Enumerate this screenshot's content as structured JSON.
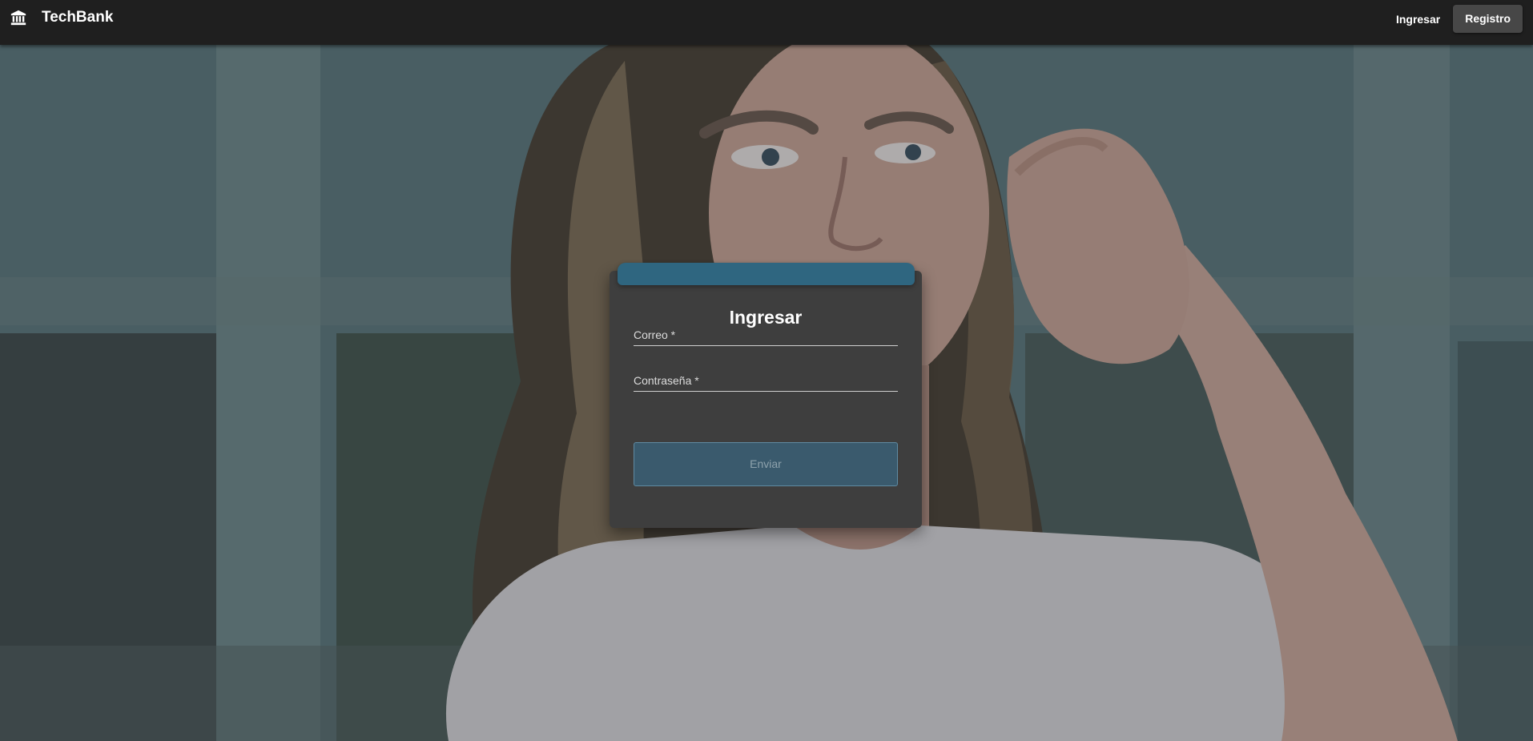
{
  "navbar": {
    "brand_icon": "bank-icon",
    "brand_title": "TechBank",
    "login_link": "Ingresar",
    "register_button": "Registro"
  },
  "hero": {
    "image": "woman-portrait-photo"
  },
  "login_form": {
    "title": "Ingresar",
    "email_label": "Correo *",
    "password_label": "Contraseña *",
    "submit_label": "Enviar"
  },
  "colors": {
    "navbar": "#1f1f1f",
    "card": "#3e3e3e",
    "accent": "#2f6680",
    "submit_disabled": "#3a5a6d"
  }
}
